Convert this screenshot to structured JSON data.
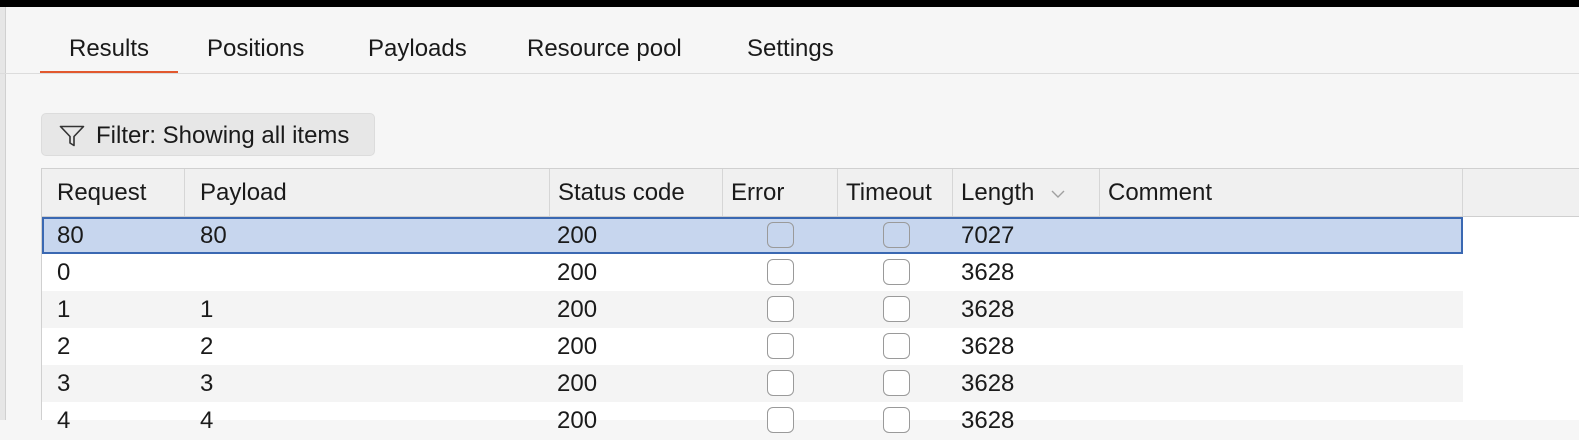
{
  "tabs": [
    {
      "label": "Results",
      "active": true
    },
    {
      "label": "Positions"
    },
    {
      "label": "Payloads"
    },
    {
      "label": "Resource pool"
    },
    {
      "label": "Settings"
    }
  ],
  "accent_color": "#e2582e",
  "selection_color": "#c7d6ee",
  "filter": {
    "label": "Filter: Showing all items",
    "icon": "filter-funnel-icon"
  },
  "table": {
    "columns": [
      "Request",
      "Payload",
      "Status code",
      "Error",
      "Timeout",
      "Length",
      "Comment"
    ],
    "sort_column": "Length",
    "rows": [
      {
        "request": "80",
        "payload": "80",
        "status": "200",
        "error": false,
        "timeout": false,
        "length": "7027",
        "comment": "",
        "selected": true
      },
      {
        "request": "0",
        "payload": "",
        "status": "200",
        "error": false,
        "timeout": false,
        "length": "3628",
        "comment": ""
      },
      {
        "request": "1",
        "payload": "1",
        "status": "200",
        "error": false,
        "timeout": false,
        "length": "3628",
        "comment": ""
      },
      {
        "request": "2",
        "payload": "2",
        "status": "200",
        "error": false,
        "timeout": false,
        "length": "3628",
        "comment": ""
      },
      {
        "request": "3",
        "payload": "3",
        "status": "200",
        "error": false,
        "timeout": false,
        "length": "3628",
        "comment": ""
      },
      {
        "request": "4",
        "payload": "4",
        "status": "200",
        "error": false,
        "timeout": false,
        "length": "3628",
        "comment": ""
      }
    ]
  }
}
